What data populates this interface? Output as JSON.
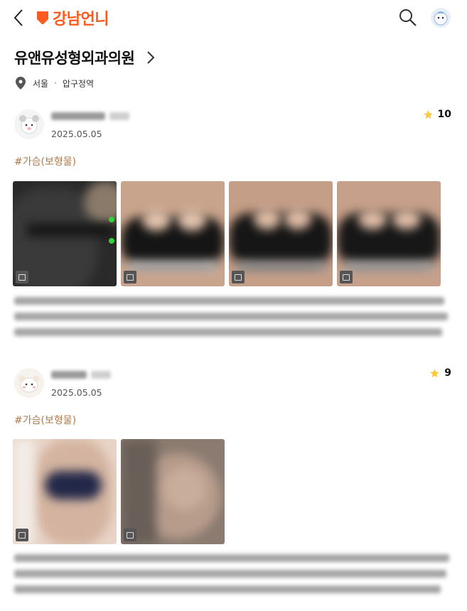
{
  "header": {
    "logo_text": "강남언니",
    "brand_color": "#ff5a1f",
    "back_icon": "chevron-left-icon",
    "search_icon": "search-icon",
    "profile_icon": "avatar-icon"
  },
  "hospital": {
    "name": "유앤유성형외과의원",
    "region": "서울",
    "district": "압구정역",
    "location_icon": "map-pin-icon"
  },
  "reviews": [
    {
      "date": "2025.05.05",
      "score": "10",
      "tag": "#가슴(보형물)",
      "photo_count": 4,
      "star_color": "#ffc83d"
    },
    {
      "date": "2025.05.05",
      "score": "9",
      "tag": "#가슴(보형물)",
      "photo_count": 2,
      "star_color": "#ffc83d"
    }
  ]
}
